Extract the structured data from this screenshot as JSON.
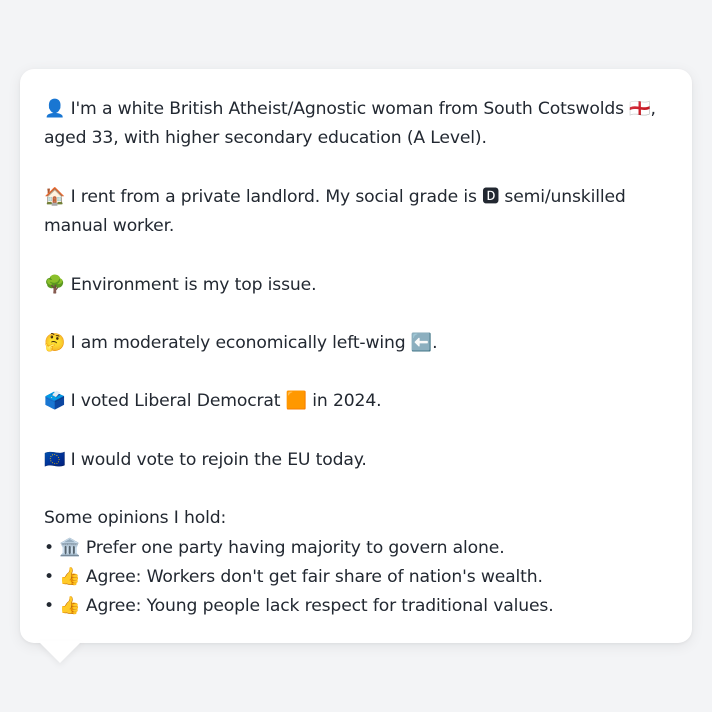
{
  "profile": {
    "identity": "👤 I'm a white British Atheist/Agnostic woman from South Cotswolds 🏴󠁧󠁢󠁥󠁮󠁧󠁿, aged 33, with higher secondary education (A Level).",
    "housing": "🏠 I rent from a private landlord. My social grade is 🅳 semi/unskilled manual worker.",
    "top_issue": "🌳 Environment is my top issue.",
    "economics": "🤔 I am moderately economically left-wing ⬅️.",
    "vote_2024": "🗳️ I voted Liberal Democrat 🟧 in 2024.",
    "eu": "🇪🇺 I would vote to rejoin the EU today."
  },
  "opinions": {
    "heading": "Some opinions I hold:",
    "items": [
      "• 🏛️ Prefer one party having majority to govern alone.",
      "• 👍 Agree: Workers don't get fair share of nation's wealth.",
      "• 👍 Agree: Young people lack respect for traditional values."
    ]
  }
}
